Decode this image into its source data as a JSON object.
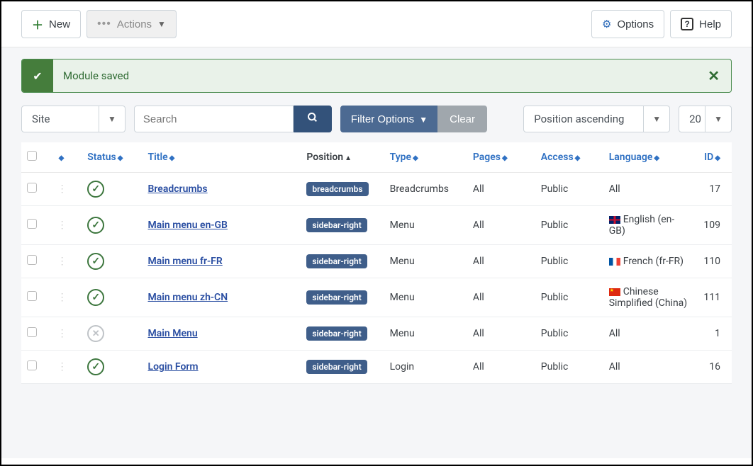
{
  "toolbar": {
    "new_label": "New",
    "actions_label": "Actions",
    "options_label": "Options",
    "help_label": "Help"
  },
  "alert": {
    "message": "Module saved"
  },
  "filters": {
    "site_label": "Site",
    "search_placeholder": "Search",
    "filter_options_label": "Filter Options",
    "clear_label": "Clear",
    "sort_label": "Position ascending",
    "limit_label": "20"
  },
  "columns": {
    "status": "Status",
    "title": "Title",
    "position": "Position",
    "type": "Type",
    "pages": "Pages",
    "access": "Access",
    "language": "Language",
    "id": "ID"
  },
  "rows": [
    {
      "status": "published",
      "title": "Breadcrumbs",
      "position": "breadcrumbs",
      "type": "Breadcrumbs",
      "pages": "All",
      "access": "Public",
      "language": "All",
      "flag": "",
      "id": "17"
    },
    {
      "status": "published",
      "title": "Main menu en-GB",
      "position": "sidebar-right",
      "type": "Menu",
      "pages": "All",
      "access": "Public",
      "language": "English (en-GB)",
      "flag": "gb",
      "id": "109"
    },
    {
      "status": "published",
      "title": "Main menu fr-FR",
      "position": "sidebar-right",
      "type": "Menu",
      "pages": "All",
      "access": "Public",
      "language": "French (fr-FR)",
      "flag": "fr",
      "id": "110"
    },
    {
      "status": "published",
      "title": "Main menu zh-CN",
      "position": "sidebar-right",
      "type": "Menu",
      "pages": "All",
      "access": "Public",
      "language": "Chinese Simplified (China)",
      "flag": "cn",
      "id": "111"
    },
    {
      "status": "unpublished",
      "title": "Main Menu",
      "position": "sidebar-right",
      "type": "Menu",
      "pages": "All",
      "access": "Public",
      "language": "All",
      "flag": "",
      "id": "1"
    },
    {
      "status": "published",
      "title": "Login Form",
      "position": "sidebar-right",
      "type": "Login",
      "pages": "All",
      "access": "Public",
      "language": "All",
      "flag": "",
      "id": "16"
    }
  ]
}
